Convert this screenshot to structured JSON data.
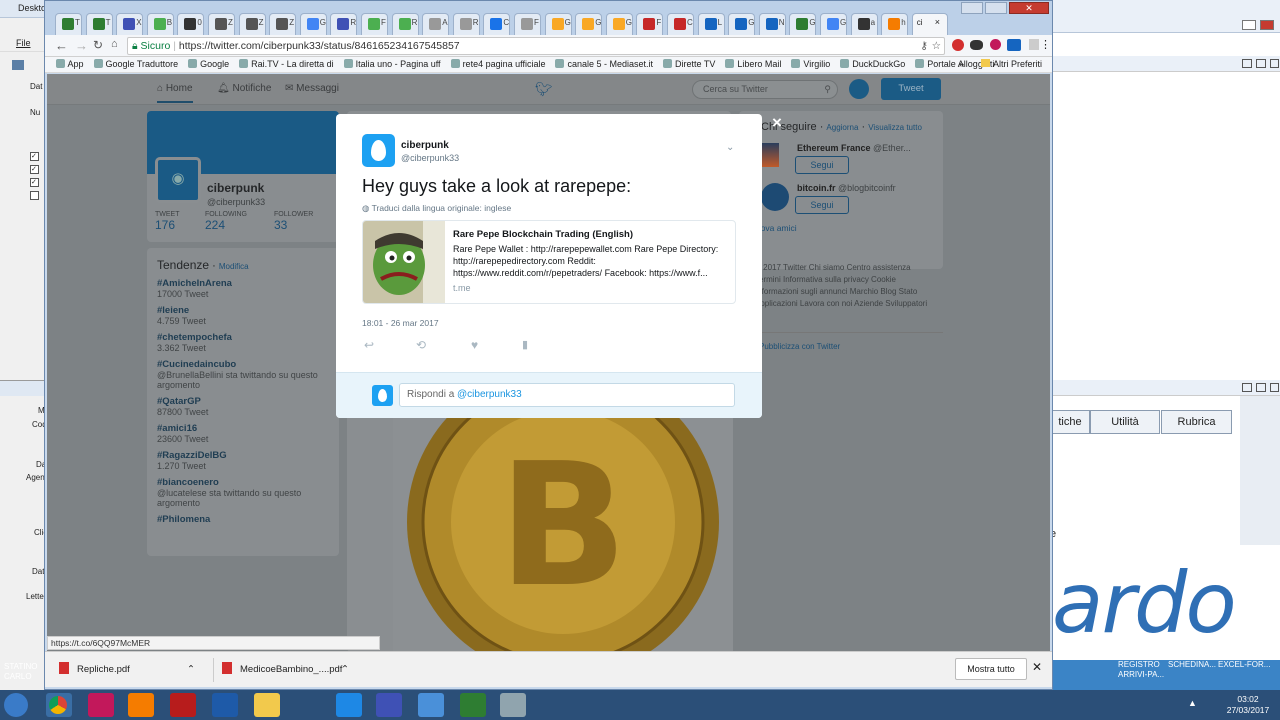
{
  "window_title": "Deskto",
  "tabs": [
    {
      "label": "T",
      "color": "#2e7d32"
    },
    {
      "label": "T",
      "color": "#2e7d32"
    },
    {
      "label": "X",
      "color": "#3f51b5"
    },
    {
      "label": "B",
      "color": "#4caf50"
    },
    {
      "label": "0",
      "color": "#333"
    },
    {
      "label": "Z",
      "color": "#555"
    },
    {
      "label": "Z",
      "color": "#555"
    },
    {
      "label": "Z",
      "color": "#555"
    },
    {
      "label": "G",
      "color": "#4285f4"
    },
    {
      "label": "R",
      "color": "#3f51b5"
    },
    {
      "label": "F",
      "color": "#4caf50"
    },
    {
      "label": "R",
      "color": "#4caf50"
    },
    {
      "label": "A",
      "color": "#999"
    },
    {
      "label": "R",
      "color": "#999"
    },
    {
      "label": "C",
      "color": "#1a73e8"
    },
    {
      "label": "F",
      "color": "#999"
    },
    {
      "label": "G",
      "color": "#f9a825"
    },
    {
      "label": "G",
      "color": "#f9a825"
    },
    {
      "label": "G",
      "color": "#f9a825"
    },
    {
      "label": "F",
      "color": "#c62828"
    },
    {
      "label": "C",
      "color": "#c62828"
    },
    {
      "label": "L",
      "color": "#1565c0"
    },
    {
      "label": "G",
      "color": "#1565c0"
    },
    {
      "label": "N",
      "color": "#1565c0"
    },
    {
      "label": "G",
      "color": "#2e7d32"
    },
    {
      "label": "G",
      "color": "#4285f4"
    },
    {
      "label": "a",
      "color": "#333"
    },
    {
      "label": "h",
      "color": "#f57c00"
    }
  ],
  "active_tab": {
    "label": "ci",
    "close": "×"
  },
  "address": {
    "secure_label": "Sicuro",
    "url": "https://twitter.com/ciberpunk33/status/846165234167545857"
  },
  "bookmarks": [
    "App",
    "Google Traduttore",
    "Google",
    "Rai.TV - La diretta di",
    "Italia uno - Pagina uff",
    "rete4 pagina ufficiale",
    "canale 5 - Mediaset.it",
    "Dirette TV",
    "Libero Mail",
    "Virgilio",
    "DuckDuckGo",
    "Portale Alloggiati"
  ],
  "bookmarks_more": "»",
  "bookmarks_other": "Altri Preferiti",
  "twitter": {
    "nav": {
      "home": "Home",
      "notifications": "Notifiche",
      "messages": "Messaggi",
      "search_placeholder": "Cerca su Twitter",
      "tweet_button": "Tweet"
    },
    "profile": {
      "name": "ciberpunk",
      "handle": "@ciberpunk33",
      "stats": [
        {
          "label": "TWEET",
          "value": "176"
        },
        {
          "label": "FOLLOWING",
          "value": "224"
        },
        {
          "label": "FOLLOWER",
          "value": "33"
        }
      ]
    },
    "trends": {
      "title": "Tendenze",
      "edit": "Modifica",
      "items": [
        {
          "tag": "#AmicheInArena",
          "sub": "17000 Tweet"
        },
        {
          "tag": "#leiene",
          "sub": "4.759 Tweet"
        },
        {
          "tag": "#chetempochefa",
          "sub": "3.362 Tweet"
        },
        {
          "tag": "#Cucinedaincubo",
          "sub": "@BrunellaBellini sta twittando su questo argomento"
        },
        {
          "tag": "#QatarGP",
          "sub": "87800 Tweet"
        },
        {
          "tag": "#amici16",
          "sub": "23600 Tweet"
        },
        {
          "tag": "#RagazziDelBG",
          "sub": "1.270 Tweet"
        },
        {
          "tag": "#biancoenero",
          "sub": "@lucatelese sta twittando su questo argomento"
        },
        {
          "tag": "#Philomena",
          "sub": ""
        }
      ]
    },
    "who_to_follow": {
      "title": "Chi seguire",
      "refresh": "Aggiorna",
      "view_all": "Visualizza tutto",
      "follow_label": "Segui",
      "more": "Trova amici",
      "accounts": [
        {
          "name": "Ethereum France",
          "handle": "@Ether..."
        },
        {
          "name": "bitcoin.fr",
          "handle": "@blogbitcoinfr"
        }
      ]
    },
    "footer_links": "© 2017 Twitter  Chi siamo  Centro assistenza  Termini  Informativa sulla privacy  Cookie  Informazioni sugli annunci  Marchio  Blog  Stato  Applicazioni  Lavora con noi  Aziende  Sviluppatori",
    "advertise": "Pubblicizza con Twitter"
  },
  "modal": {
    "close": "×",
    "author_name": "ciberpunk",
    "author_handle": "@ciberpunk33",
    "text": "Hey guys take a look at rarepepe:",
    "translate": "Traduci dalla lingua originale: inglese",
    "card": {
      "title": "Rare Pepe Blockchain Trading (English)",
      "description": "Rare Pepe Wallet : http://rarepepewallet.com Rare Pepe Directory: http://rarepepedirectory.com Reddit: https://www.reddit.com/r/pepetraders/ Facebook: https://www.f...",
      "domain": "t.me"
    },
    "timestamp": "18:01 - 26 mar 2017",
    "reply_placeholder": "Rispondi a ",
    "reply_mention": "@ciberpunk33"
  },
  "status_url": "https://t.co/6QQ97McMER",
  "downloads": [
    {
      "name": "Repliche.pdf"
    },
    {
      "name": "MedicoeBambino_....pdf"
    }
  ],
  "download_show_all": "Mostra tutto",
  "right_app": {
    "buttons": [
      "tiche",
      "Utilità",
      "Rubrica"
    ],
    "brand": "ardo",
    "letter": "e"
  },
  "left_app": {
    "menu": [
      "File"
    ],
    "labels": [
      "Dat",
      "Nu",
      "M",
      "Cod",
      "Da",
      "Agen",
      "Clie",
      "Dat",
      "Letter"
    ]
  },
  "taskbar": {
    "time": "03:02",
    "date": "27/03/2017",
    "items": [
      "REGISTRO ARRIVI-PA...",
      "SCHEDINA...",
      "EXCEL-FOR..."
    ],
    "left_text": "STATINO CARLO"
  }
}
